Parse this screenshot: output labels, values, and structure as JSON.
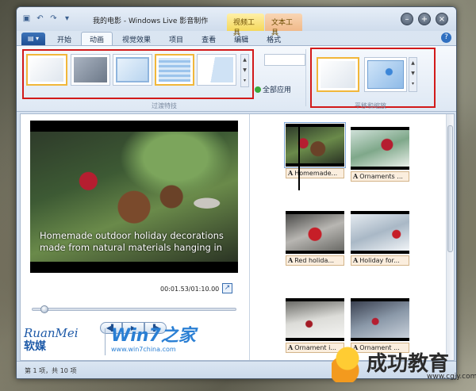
{
  "window": {
    "title": "我的电影 - Windows Live 影音制作",
    "context_tabs": {
      "video": "视频工具",
      "text": "文本工具"
    },
    "controls": {
      "minimize": "–",
      "maximize": "+",
      "close": "×"
    }
  },
  "quick_access": {
    "save": "▣",
    "undo": "↶",
    "redo": "↷",
    "more": "▾"
  },
  "ribbon": {
    "app_button": "▤ ▾",
    "tabs": [
      {
        "label": "开始",
        "active": false
      },
      {
        "label": "动画",
        "active": true
      },
      {
        "label": "视觉效果",
        "active": false
      },
      {
        "label": "项目",
        "active": false
      },
      {
        "label": "查看",
        "active": false
      },
      {
        "label": "编辑",
        "active": false
      },
      {
        "label": "格式",
        "active": false
      }
    ],
    "help": "?",
    "transitions_group_label": "过渡特技",
    "apply_all_label": "全部应用",
    "pan_zoom_group_label": "平移和缩放",
    "scroll_up": "▲",
    "scroll_down": "▼",
    "scroll_more": "▾"
  },
  "preview": {
    "caption": "Homemade outdoor holiday decorations made from natural materials hanging in",
    "timecode": "00:01.53/01:10.00",
    "fullscreen_glyph": "↗",
    "playback": {
      "prev": "◀▌",
      "play": "▶",
      "next": "▐▶"
    },
    "seek_position": 0.04
  },
  "storyboard": {
    "clips": [
      {
        "label": "Homemade..."
      },
      {
        "label": "Ornaments ..."
      },
      {
        "label": "Red holida..."
      },
      {
        "label": "Holiday for..."
      },
      {
        "label": "Ornament i..."
      },
      {
        "label": "Ornament ..."
      }
    ],
    "text_marker": "A"
  },
  "status": {
    "text": "第 1 项，共 10 项"
  },
  "watermarks": {
    "ruanmei_latin": "RuanMei",
    "ruanmei_cn": "软媒",
    "win7_main": "Win7之家",
    "win7_url": "www.win7china.com",
    "edu_name": "成功教育",
    "edu_url": "www.cgjy.com"
  }
}
